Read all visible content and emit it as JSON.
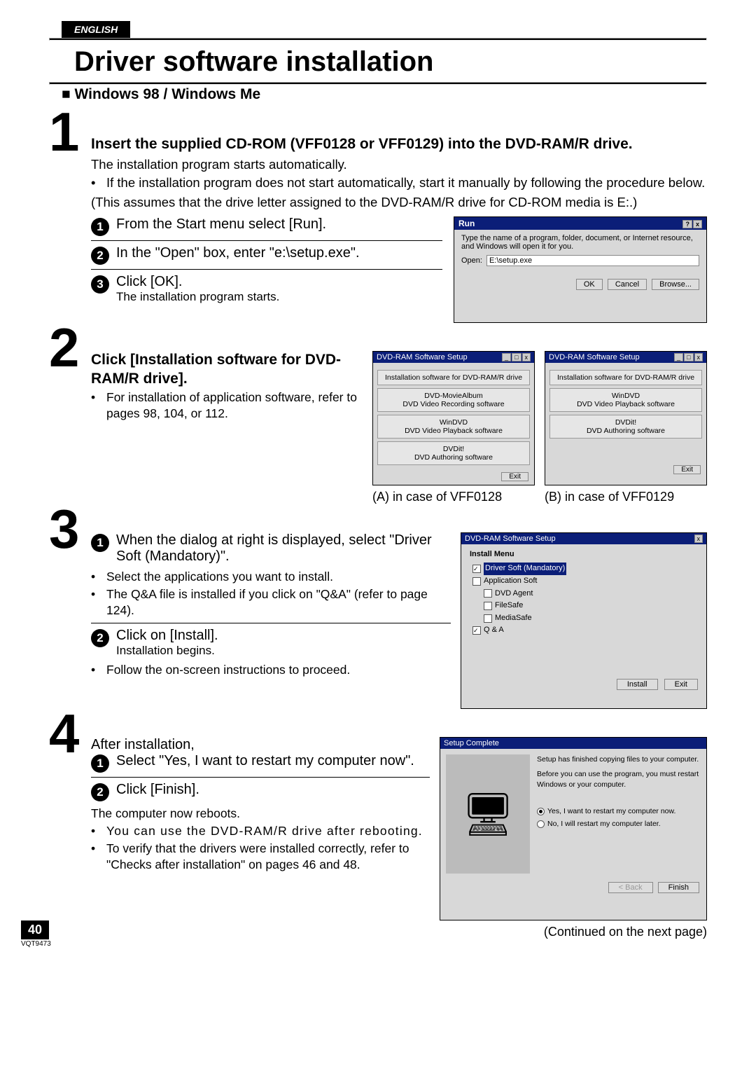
{
  "lang_tab": "ENGLISH",
  "title": "Driver software installation",
  "subtitle": "Windows 98 / Windows Me",
  "step1": {
    "num": "1",
    "heading": "Insert the supplied CD-ROM (VFF0128 or VFF0129) into the DVD-RAM/R drive.",
    "line1": "The installation program starts automatically.",
    "bullet1": "If the installation program does not start automatically, start it manually by following the procedure below.",
    "line2": "(This assumes that the drive letter assigned to the DVD-RAM/R drive for CD-ROM media is E:.)",
    "sub1": "From the Start menu select [Run].",
    "sub2": "In the \"Open\" box, enter \"e:\\setup.exe\".",
    "sub3": "Click [OK].",
    "sub3_note": "The installation program starts.",
    "run": {
      "title": "Run",
      "desc": "Type the name of a program, folder, document, or Internet resource, and Windows will open it for you.",
      "open_label": "Open:",
      "open_value": "E:\\setup.exe",
      "ok": "OK",
      "cancel": "Cancel",
      "browse": "Browse..."
    }
  },
  "step2": {
    "num": "2",
    "heading": "Click [Installation software for DVD-RAM/R drive].",
    "bullet1": "For installation of application software, refer to pages 98, 104, or 112.",
    "captionA": "(A) in case of VFF0128",
    "captionB": "(B) in case of VFF0129",
    "setupA": {
      "title": "DVD-RAM Software Setup",
      "top": "Installation software for DVD-RAM/R drive",
      "i1a": "DVD-MovieAlbum",
      "i1b": "DVD Video Recording software",
      "i2a": "WinDVD",
      "i2b": "DVD Video Playback software",
      "i3a": "DVDit!",
      "i3b": "DVD Authoring software",
      "exit": "Exit"
    },
    "setupB": {
      "title": "DVD-RAM Software Setup",
      "top": "Installation software for DVD-RAM/R drive",
      "i1a": "WinDVD",
      "i1b": "DVD Video Playback software",
      "i2a": "DVDit!",
      "i2b": "DVD Authoring software",
      "exit": "Exit"
    }
  },
  "step3": {
    "num": "3",
    "sub1": "When the dialog at right is displayed, select \"Driver Soft (Mandatory)\".",
    "bullet1": "Select the applications you want to install.",
    "bullet2": "The Q&A file is installed if you click on \"Q&A\" (refer to page 124).",
    "sub2": "Click on [Install].",
    "sub2_note": "Installation begins.",
    "bullet3": "Follow the on-screen instructions to proceed.",
    "menu": {
      "title": "DVD-RAM Software Setup",
      "header": "Install Menu",
      "item1": "Driver Soft (Mandatory)",
      "item2": "Application Soft",
      "item3": "DVD Agent",
      "item4": "FileSafe",
      "item5": "MediaSafe",
      "item6": "Q & A",
      "install": "Install",
      "exit": "Exit"
    }
  },
  "step4": {
    "num": "4",
    "line1": "After installation,",
    "sub1": "Select \"Yes, I want to restart my computer now\".",
    "sub2": "Click [Finish].",
    "line2": "The computer now reboots.",
    "bullet1": "You can use the DVD-RAM/R drive after rebooting.",
    "bullet2": "To verify that the drivers were installed correctly, refer to \"Checks after installation\" on pages 46 and 48.",
    "complete": {
      "title": "Setup Complete",
      "msg1": "Setup has finished copying files to your computer.",
      "msg2": "Before you can use the program, you must restart Windows or your computer.",
      "opt1": "Yes, I want to restart my computer now.",
      "opt2": "No, I will restart my computer later.",
      "back": "< Back",
      "finish": "Finish"
    }
  },
  "page_number": "40",
  "doc_code": "VQT9473",
  "continued": "(Continued on the next page)"
}
